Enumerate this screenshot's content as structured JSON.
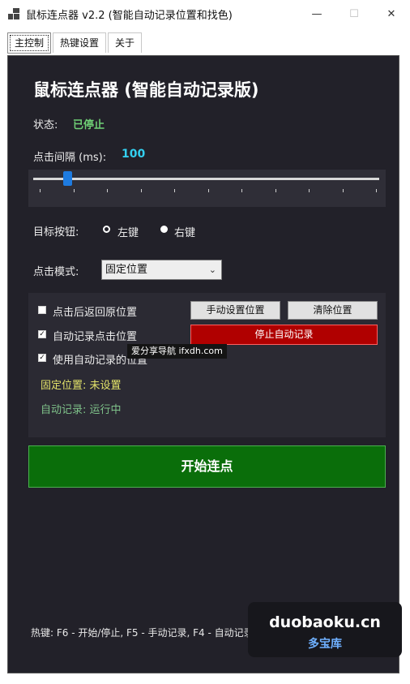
{
  "window": {
    "title": "鼠标连点器 v2.2 (智能自动记录位置和找色)",
    "minimize_glyph": "—",
    "maximize_glyph": "☐",
    "close_glyph": "✕"
  },
  "tabs": [
    {
      "label": "主控制",
      "active": true
    },
    {
      "label": "热键设置",
      "active": false
    },
    {
      "label": "关于",
      "active": false
    }
  ],
  "main": {
    "heading": "鼠标连点器 (智能自动记录版)",
    "status_label": "状态:",
    "status_value": "已停止",
    "interval_label": "点击间隔 (ms):",
    "interval_value": "100",
    "slider_level": 0.1,
    "target_label": "目标按钮:",
    "target_options": [
      {
        "label": "左键",
        "selected": true
      },
      {
        "label": "右键",
        "selected": false
      }
    ],
    "mode_label": "点击模式:",
    "mode_value": "固定位置",
    "options": {
      "return_after_click": {
        "label": "点击后返回原位置",
        "checked": false
      },
      "auto_record": {
        "label": "自动记录点击位置",
        "checked": true
      },
      "use_recorded": {
        "label": "使用自动记录的位置",
        "checked": true
      }
    },
    "manual_set_button": "手动设置位置",
    "clear_button": "清除位置",
    "stop_record_button": "停止自动记录",
    "fixed_position_text": "固定位置: 未设置",
    "auto_record_text": "自动记录: 运行中",
    "start_button": "开始连点",
    "hotkeys_text": "热键: F6 - 开始/停止, F5 - 手动记录, F4 - 自动记录"
  },
  "overlay": {
    "tooltip": "爱分享导航 ifxdh.com",
    "watermark_main": "duobaoku.cn",
    "watermark_sub": "多宝库"
  },
  "colors": {
    "panel_bg": "#222129",
    "status_green": "#6fcf75",
    "interval_cyan": "#33d0f0",
    "stop_red": "#b00000",
    "start_green": "#0a6e0a",
    "fixed_yellow": "#e3e36a"
  }
}
